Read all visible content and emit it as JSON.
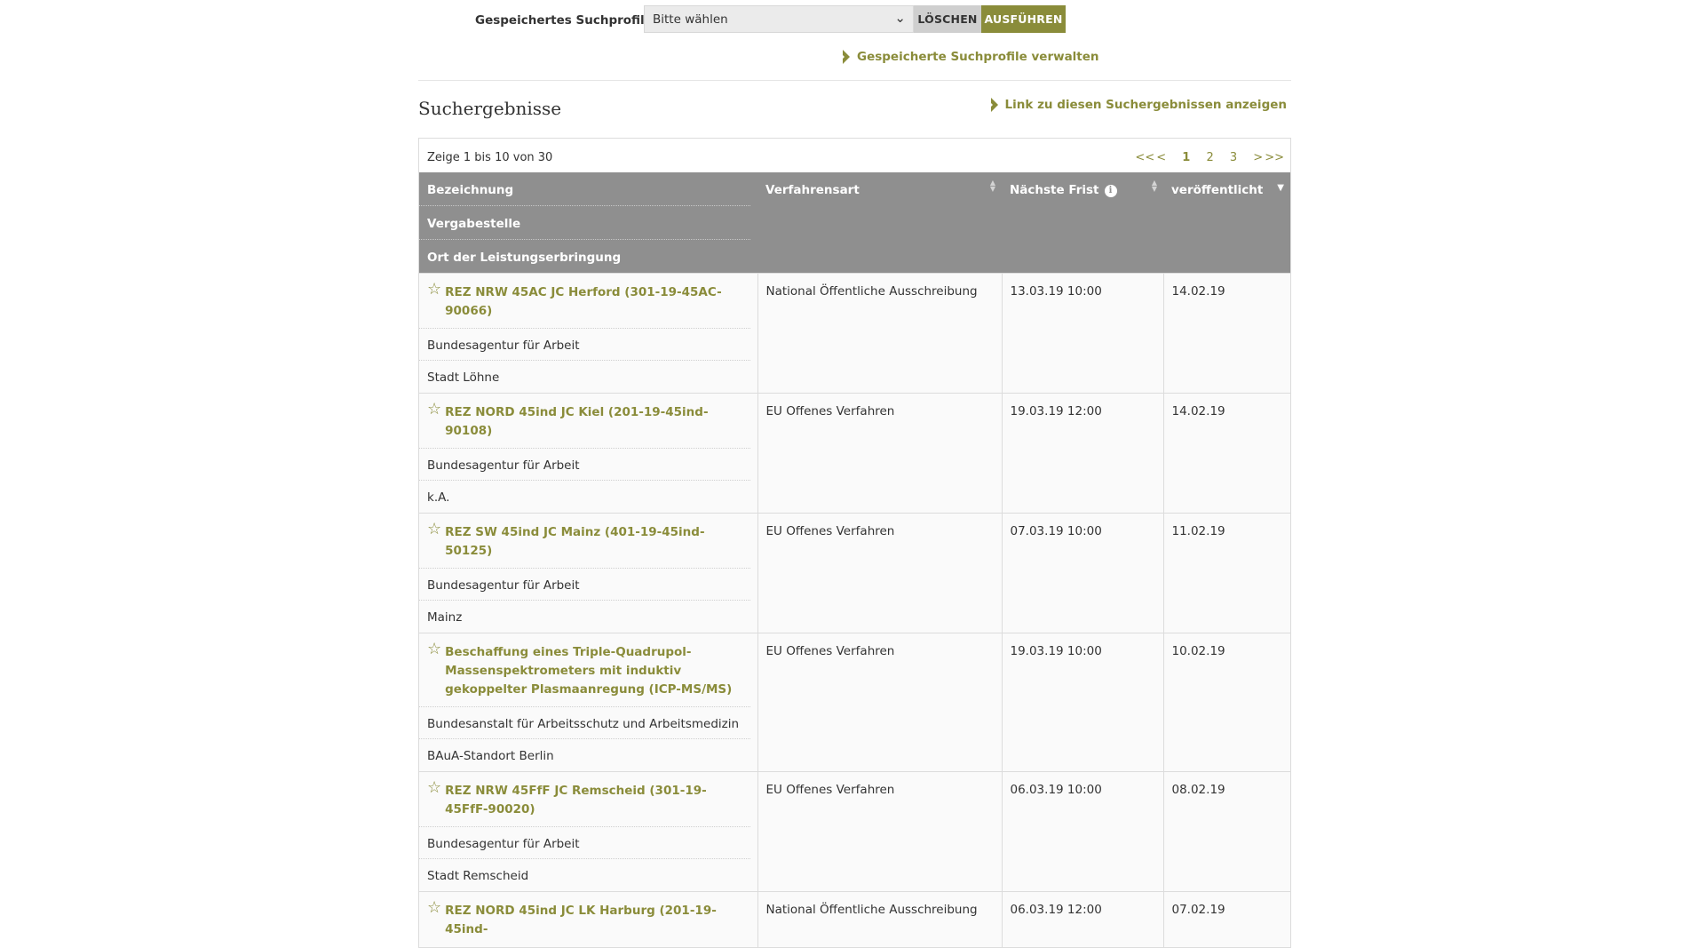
{
  "profile": {
    "label": "Gespeichertes Suchprofil",
    "select_value": "Bitte wählen",
    "delete_label": "LÖSCHEN",
    "run_label": "AUSFÜHREN",
    "manage_link": "Gespeicherte Suchprofile verwalten"
  },
  "results": {
    "title": "Suchergebnisse",
    "permalink": "Link zu diesen Suchergebnissen anzeigen",
    "pager_info": "Zeige 1 bis 10 von 30",
    "pager": {
      "first": "<<",
      "prev": "<",
      "pages": [
        "1",
        "2",
        "3"
      ],
      "next": ">",
      "last": ">>",
      "current": "1"
    },
    "columns": {
      "bezeichnung": "Bezeichnung",
      "vergabestelle": "Vergabestelle",
      "ort": "Ort der Leistungserbringung",
      "verfahrensart": "Verfahrensart",
      "frist": "Nächste Frist",
      "veroeffentlicht": "veröffentlicht"
    },
    "rows": [
      {
        "title": "REZ NRW 45AC JC Herford (301-19-45AC-90066)",
        "vergabestelle": "Bundesagentur für Arbeit",
        "ort": "Stadt Löhne",
        "verfahrensart": "National Öffentliche Ausschreibung",
        "frist": "13.03.19 10:00",
        "veroeffentlicht": "14.02.19"
      },
      {
        "title": "REZ NORD 45ind JC Kiel (201-19-45ind-90108)",
        "vergabestelle": "Bundesagentur für Arbeit",
        "ort": "k.A.",
        "verfahrensart": "EU Offenes Verfahren",
        "frist": "19.03.19 12:00",
        "veroeffentlicht": "14.02.19"
      },
      {
        "title": "REZ SW 45ind JC Mainz (401-19-45ind-50125)",
        "vergabestelle": "Bundesagentur für Arbeit",
        "ort": "Mainz",
        "verfahrensart": "EU Offenes Verfahren",
        "frist": "07.03.19 10:00",
        "veroeffentlicht": "11.02.19"
      },
      {
        "title": "Beschaffung eines Triple-Quadrupol-Massenspektrometers mit induktiv gekoppelter Plasmaanregung (ICP-MS/MS)",
        "vergabestelle": "Bundesanstalt für Arbeitsschutz und Arbeitsmedizin",
        "ort": "BAuA-Standort Berlin",
        "verfahrensart": "EU Offenes Verfahren",
        "frist": "19.03.19 10:00",
        "veroeffentlicht": "10.02.19"
      },
      {
        "title": "REZ NRW 45FfF JC Remscheid (301-19-45FfF-90020)",
        "vergabestelle": "Bundesagentur für Arbeit",
        "ort": "Stadt Remscheid",
        "verfahrensart": "EU Offenes Verfahren",
        "frist": "06.03.19 10:00",
        "veroeffentlicht": "08.02.19"
      },
      {
        "title": "REZ NORD 45ind JC LK Harburg (201-19-45ind-",
        "vergabestelle": "",
        "ort": "",
        "verfahrensart": "National Öffentliche Ausschreibung",
        "frist": "06.03.19 12:00",
        "veroeffentlicht": "07.02.19"
      }
    ]
  },
  "colors": {
    "accent": "#8a8c3a",
    "header_bg": "#8f8f8f",
    "button_grey": "#cfcfcf"
  },
  "icons": [
    "chevron-down-icon",
    "arrow-right-icon",
    "star-icon",
    "info-icon",
    "sort-icon"
  ]
}
